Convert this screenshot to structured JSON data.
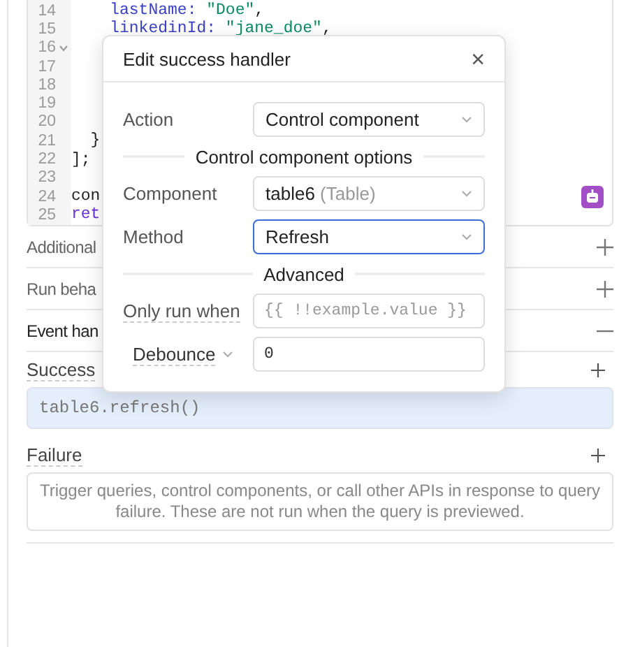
{
  "editor": {
    "lines": [
      {
        "number": "14",
        "code": [
          {
            "t": "    lastName: ",
            "color": "#3a40c4"
          },
          {
            "t": "\"Doe\"",
            "color": "#0a8a62"
          },
          {
            "t": ",",
            "color": "#222222"
          }
        ],
        "foldable": false
      },
      {
        "number": "15",
        "code": [
          {
            "t": "    linkedinId: ",
            "color": "#3a40c4"
          },
          {
            "t": "\"jane_doe\"",
            "color": "#0a8a62"
          },
          {
            "t": ",",
            "color": "#222222"
          }
        ],
        "foldable": false
      },
      {
        "number": "16",
        "foldable": true
      },
      {
        "number": "17",
        "foldable": false
      },
      {
        "number": "18",
        "foldable": false
      },
      {
        "number": "19",
        "foldable": false
      },
      {
        "number": "20",
        "foldable": false
      },
      {
        "number": "21",
        "code": [
          {
            "t": "  }",
            "color": "#222222"
          }
        ],
        "foldable": false
      },
      {
        "number": "22",
        "code": [
          {
            "t": "];",
            "color": "#222222"
          }
        ],
        "foldable": false
      },
      {
        "number": "23",
        "foldable": false
      },
      {
        "number": "24",
        "code": [
          {
            "t": "con",
            "color": "#222222"
          }
        ],
        "foldable": false
      },
      {
        "number": "25",
        "code": [
          {
            "t": "ret",
            "color": "#6b2fd4"
          }
        ],
        "foldable": false
      }
    ]
  },
  "sections": [
    {
      "label": "Additional",
      "expanded": false
    },
    {
      "label": "Run beha",
      "expanded": false
    },
    {
      "label": "Event han",
      "expanded": true
    }
  ],
  "success": {
    "label": "Success",
    "handlers": [
      "table6.refresh()"
    ]
  },
  "failure": {
    "label": "Failure",
    "empty_text": "Trigger queries, control components, or call other APIs in response to query failure. These are not run when the query is previewed."
  },
  "modal": {
    "title": "Edit success handler",
    "close": "×",
    "action": {
      "label": "Action",
      "value": "Control component"
    },
    "options_heading": "Control component options",
    "component": {
      "label": "Component",
      "value": "table6",
      "type": "(Table)"
    },
    "method": {
      "label": "Method",
      "value": "Refresh",
      "focused": true
    },
    "advanced_heading": "Advanced",
    "only_run_when": {
      "label": "Only run when",
      "placeholder": "{{ !!example.value }}"
    },
    "debounce": {
      "label": "Debounce",
      "value": "0"
    }
  }
}
